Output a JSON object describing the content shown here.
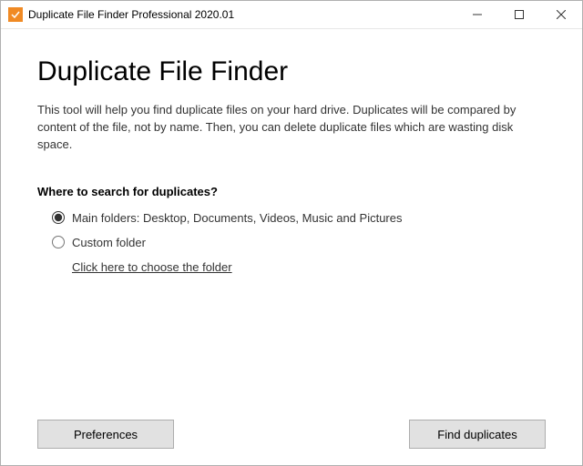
{
  "window": {
    "title": "Duplicate File Finder Professional 2020.01"
  },
  "main": {
    "heading": "Duplicate File Finder",
    "description": "This tool will help you find duplicate files on your hard drive. Duplicates will be compared by content of the file, not by name. Then, you can delete duplicate files which are wasting disk space.",
    "section_label": "Where to search for duplicates?",
    "options": {
      "main_folders": "Main folders: Desktop, Documents, Videos, Music and Pictures",
      "custom_folder": "Custom folder",
      "choose_link": "Click here to choose the folder",
      "selected": "main_folders"
    }
  },
  "buttons": {
    "preferences": "Preferences",
    "find": "Find duplicates"
  }
}
